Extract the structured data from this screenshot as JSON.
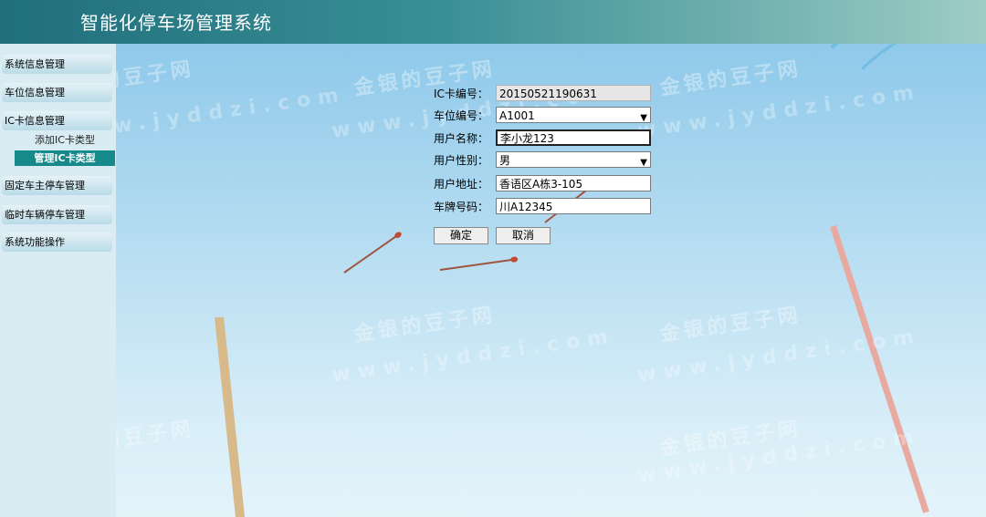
{
  "header": {
    "title": "智能化停车场管理系统"
  },
  "sidebar": {
    "menu": [
      {
        "label": "系统信息管理"
      },
      {
        "label": "车位信息管理"
      },
      {
        "label": "IC卡信息管理"
      },
      {
        "label": "固定车主停车管理"
      },
      {
        "label": "临时车辆停车管理"
      },
      {
        "label": "系统功能操作"
      }
    ],
    "sub": [
      {
        "label": "添加IC卡类型"
      },
      {
        "label": "管理IC卡类型"
      }
    ]
  },
  "form": {
    "card_no": {
      "label": "IC卡编号：",
      "value": "20150521190631"
    },
    "spot_no": {
      "label": "车位编号：",
      "value": "A1001"
    },
    "user_name": {
      "label": "用户名称：",
      "value": "李小龙123"
    },
    "user_gender": {
      "label": "用户性别：",
      "value": "男"
    },
    "user_address": {
      "label": "用户地址：",
      "value": "香语区A栋3-105"
    },
    "plate_no": {
      "label": "车牌号码：",
      "value": "川A12345"
    },
    "confirm_label": "确定",
    "cancel_label": "取消"
  },
  "watermark": {
    "brand": "金银的豆子网",
    "url": "www.jyddzi.com"
  }
}
